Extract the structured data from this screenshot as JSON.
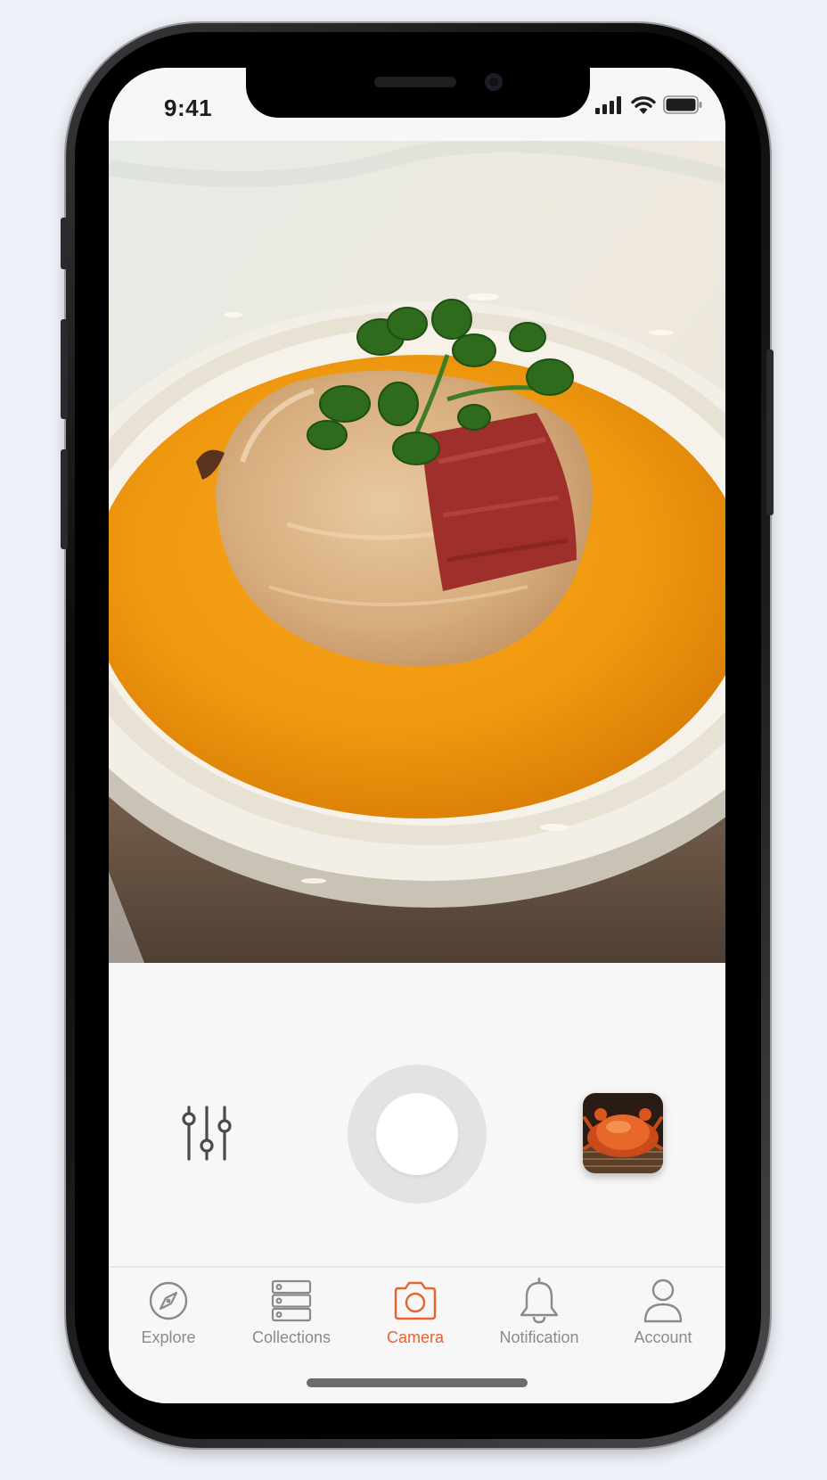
{
  "status_bar": {
    "time": "9:41",
    "icons": [
      "cellular-signal-icon",
      "wifi-icon",
      "battery-icon"
    ]
  },
  "viewfinder": {
    "subject": "bowl of soup with parsley garnish and ham slice",
    "icon": "camera-preview"
  },
  "controls": {
    "filter_icon": "sliders-icon",
    "shutter_icon": "shutter-button",
    "gallery_thumbnail": "steamed-crab-photo"
  },
  "tab_bar": {
    "active_color": "#e8622d",
    "inactive_color": "#8a8a8e",
    "tabs": [
      {
        "label": "Explore",
        "icon": "compass-icon",
        "active": false
      },
      {
        "label": "Collections",
        "icon": "stacked-drawers-icon",
        "active": false
      },
      {
        "label": "Camera",
        "icon": "camera-icon",
        "active": true
      },
      {
        "label": "Notification",
        "icon": "bell-icon",
        "active": false
      },
      {
        "label": "Account",
        "icon": "user-icon",
        "active": false
      }
    ]
  }
}
